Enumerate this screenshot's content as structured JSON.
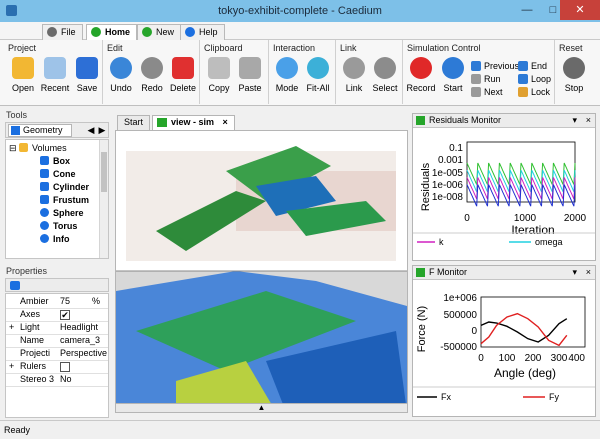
{
  "window": {
    "title": "tokyo-exhibit-complete - Caedium"
  },
  "menu": {
    "tabs": [
      {
        "label": "File",
        "color": "#6a6a6a"
      },
      {
        "label": "Home",
        "color": "#25a52a"
      },
      {
        "label": "New",
        "color": "#25a52a"
      },
      {
        "label": "Help",
        "color": "#1b6fe0"
      }
    ]
  },
  "ribbon": {
    "groups": [
      "Project",
      "Edit",
      "Clipboard",
      "Interaction",
      "Link",
      "Simulation Control",
      "Reset"
    ],
    "buttons": {
      "open": "Open",
      "recent": "Recent",
      "save": "Save",
      "undo": "Undo",
      "redo": "Redo",
      "delete": "Delete",
      "copy": "Copy",
      "paste": "Paste",
      "mode": "Mode",
      "fitall": "Fit-All",
      "link": "Link",
      "select": "Select",
      "record": "Record",
      "start": "Start",
      "previous": "Previous",
      "run": "Run",
      "next": "Next",
      "end": "End",
      "loop": "Loop",
      "lock": "Lock",
      "stop": "Stop"
    }
  },
  "tools": {
    "title": "Tools",
    "tab": "Geometry",
    "tree": {
      "root": "Volumes",
      "items": [
        "Box",
        "Cone",
        "Cylinder",
        "Frustum",
        "Sphere",
        "Torus",
        "Info"
      ]
    }
  },
  "properties": {
    "title": "Properties",
    "rows": [
      {
        "key": "Ambier",
        "value": "75",
        "unit": "%"
      },
      {
        "key": "Axes",
        "value": "✔"
      },
      {
        "key": "Light",
        "value": "Headlight",
        "expand": "+"
      },
      {
        "key": "Name",
        "value": "camera_3"
      },
      {
        "key": "Projecti",
        "value": "Perspective"
      },
      {
        "key": "Rulers",
        "value": "",
        "expand": "+"
      },
      {
        "key": "Stereo 3",
        "value": "No"
      }
    ]
  },
  "viewtabs": {
    "start": "Start",
    "view": "view - sim"
  },
  "residuals": {
    "title": "Residuals Monitor",
    "ylabel": "Residuals",
    "xlabel": "Iteration",
    "yticks": [
      "0.1",
      "0.001",
      "1e-005",
      "1e-006",
      "1e-008"
    ],
    "xticks": [
      "0",
      "1000",
      "2000"
    ],
    "legend": [
      {
        "name": "k",
        "color": "#d020c0"
      },
      {
        "name": "omega",
        "color": "#20d0e0"
      }
    ]
  },
  "fmonitor": {
    "title": "F Monitor",
    "ylabel": "Force (N)",
    "xlabel": "Angle (deg)",
    "yticks": [
      "1e+006",
      "500000",
      "0",
      "-500000"
    ],
    "xticks": [
      "0",
      "100",
      "200",
      "300",
      "400"
    ],
    "legend": [
      {
        "name": "Fx",
        "color": "#000000"
      },
      {
        "name": "Fy",
        "color": "#e02020"
      }
    ]
  },
  "chart_data": [
    {
      "type": "line",
      "title": "Residuals Monitor",
      "xlabel": "Iteration",
      "ylabel": "Residuals",
      "xlim": [
        0,
        2000
      ],
      "yscale": "log",
      "series": [
        {
          "name": "k"
        },
        {
          "name": "omega"
        }
      ]
    },
    {
      "type": "line",
      "title": "F Monitor",
      "xlabel": "Angle (deg)",
      "ylabel": "Force (N)",
      "xlim": [
        0,
        400
      ],
      "ylim": [
        -500000,
        1000000
      ],
      "series": [
        {
          "name": "Fx",
          "x": [
            0,
            30,
            60,
            100,
            140,
            180,
            220,
            260,
            300,
            330
          ],
          "values": [
            150000,
            250000,
            220000,
            120000,
            -50000,
            -250000,
            -350000,
            -150000,
            200000,
            350000
          ]
        },
        {
          "name": "Fy",
          "x": [
            0,
            30,
            60,
            100,
            140,
            180,
            220,
            260,
            300,
            330
          ],
          "values": [
            -400000,
            -200000,
            150000,
            400000,
            500000,
            350000,
            100000,
            -300000,
            -450000,
            -150000
          ]
        }
      ]
    }
  ],
  "statusbar": {
    "text": "Ready"
  }
}
